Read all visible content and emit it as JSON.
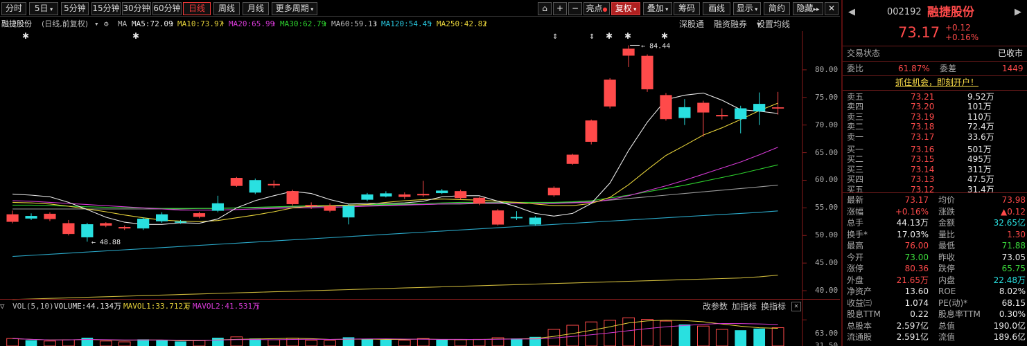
{
  "toolbar": {
    "periods": [
      "分时",
      "5日",
      "5分钟",
      "15分钟",
      "30分钟",
      "60分钟",
      "日线",
      "周线",
      "月线",
      "更多周期"
    ],
    "active_period": "日线",
    "tools": [
      "亮点",
      "复权",
      "叠加",
      "筹码",
      "画线",
      "显示",
      "简约",
      "隐藏"
    ],
    "plus": "+",
    "minus": "−"
  },
  "info": {
    "name": "融捷股份",
    "mode": "(日线,前复权)",
    "ma_label": "MA",
    "ma5": "MA5:72.09",
    "ma10": "MA10:73.97",
    "ma20": "MA20:65.99",
    "ma30": "MA30:62.79",
    "ma60": "MA60:59.13",
    "ma120": "MA120:54.45",
    "ma250": "MA250:42.82",
    "links": [
      "深股通",
      "融资融券",
      "设置均线"
    ]
  },
  "chart_data": {
    "type": "candlestick",
    "y_ticks": [
      "80.00",
      "75.00",
      "70.00",
      "65.00",
      "60.00",
      "55.00",
      "50.00",
      "45.00",
      "40.00"
    ],
    "ylim": [
      37.5,
      84.5
    ],
    "high_marker": "84.44",
    "low_marker": "48.88",
    "candles": [
      {
        "o": 52.5,
        "c": 53.8,
        "h": 54.5,
        "l": 52.2
      },
      {
        "o": 53.5,
        "c": 53.1,
        "h": 54.0,
        "l": 52.8
      },
      {
        "o": 53.0,
        "c": 53.9,
        "h": 54.2,
        "l": 52.6
      },
      {
        "o": 50.3,
        "c": 52.2,
        "h": 52.8,
        "l": 50.0
      },
      {
        "o": 52.0,
        "c": 49.7,
        "h": 52.3,
        "l": 48.88
      },
      {
        "o": 51.8,
        "c": 52.2,
        "h": 52.4,
        "l": 51.5
      },
      {
        "o": 51.3,
        "c": 51.5,
        "h": 51.8,
        "l": 51.0
      },
      {
        "o": 53.0,
        "c": 51.3,
        "h": 53.3,
        "l": 51.0
      },
      {
        "o": 53.8,
        "c": 52.6,
        "h": 54.2,
        "l": 52.3
      },
      {
        "o": 52.5,
        "c": 52.4,
        "h": 52.8,
        "l": 52.1
      },
      {
        "o": 53.4,
        "c": 54.0,
        "h": 54.3,
        "l": 53.1
      },
      {
        "o": 55.8,
        "c": 54.5,
        "h": 57.2,
        "l": 54.2
      },
      {
        "o": 59.0,
        "c": 60.4,
        "h": 60.6,
        "l": 58.8
      },
      {
        "o": 60.0,
        "c": 57.8,
        "h": 60.3,
        "l": 57.5
      },
      {
        "o": 59.1,
        "c": 59.3,
        "h": 60.0,
        "l": 58.6
      },
      {
        "o": 55.7,
        "c": 58.0,
        "h": 58.3,
        "l": 55.4
      },
      {
        "o": 55.4,
        "c": 55.5,
        "h": 56.0,
        "l": 54.8
      },
      {
        "o": 54.5,
        "c": 55.3,
        "h": 55.8,
        "l": 54.2
      },
      {
        "o": 55.3,
        "c": 53.3,
        "h": 55.6,
        "l": 52.0
      },
      {
        "o": 57.4,
        "c": 56.5,
        "h": 57.7,
        "l": 56.2
      },
      {
        "o": 57.6,
        "c": 57.1,
        "h": 58.0,
        "l": 56.9
      },
      {
        "o": 57.0,
        "c": 57.4,
        "h": 57.8,
        "l": 56.6
      },
      {
        "o": 57.3,
        "c": 57.5,
        "h": 59.9,
        "l": 57.0
      },
      {
        "o": 58.1,
        "c": 57.7,
        "h": 58.4,
        "l": 57.5
      },
      {
        "o": 56.8,
        "c": 58.0,
        "h": 58.3,
        "l": 56.5
      },
      {
        "o": 55.8,
        "c": 56.8,
        "h": 57.0,
        "l": 55.5
      },
      {
        "o": 52.0,
        "c": 54.5,
        "h": 54.8,
        "l": 51.8
      },
      {
        "o": 53.3,
        "c": 53.2,
        "h": 54.4,
        "l": 52.8
      },
      {
        "o": 53.2,
        "c": 52.0,
        "h": 53.5,
        "l": 51.8
      },
      {
        "o": 57.3,
        "c": 58.6,
        "h": 58.9,
        "l": 57.0
      },
      {
        "o": 63.0,
        "c": 64.6,
        "h": 64.8,
        "l": 62.8
      },
      {
        "o": 67.0,
        "c": 70.8,
        "h": 71.0,
        "l": 66.5
      },
      {
        "o": 73.4,
        "c": 78.2,
        "h": 78.5,
        "l": 73.0
      },
      {
        "o": 82.6,
        "c": 83.8,
        "h": 84.44,
        "l": 80.5
      },
      {
        "o": 76.5,
        "c": 82.5,
        "h": 82.8,
        "l": 76.0
      },
      {
        "o": 71.1,
        "c": 75.4,
        "h": 75.8,
        "l": 70.8
      },
      {
        "o": 73.2,
        "c": 71.3,
        "h": 74.7,
        "l": 70.0
      },
      {
        "o": 72.3,
        "c": 74.0,
        "h": 74.4,
        "l": 67.9
      },
      {
        "o": 71.6,
        "c": 71.8,
        "h": 73.0,
        "l": 71.0
      },
      {
        "o": 73.0,
        "c": 71.1,
        "h": 73.5,
        "l": 68.5
      },
      {
        "o": 73.8,
        "c": 72.5,
        "h": 75.9,
        "l": 70.0
      },
      {
        "o": 73.17,
        "c": 73.17,
        "h": 76.0,
        "l": 71.88
      }
    ],
    "ma5_line": [
      57.5,
      57.3,
      57.0,
      56.0,
      54.7,
      53.3,
      52.4,
      52.0,
      52.0,
      52.3,
      52.2,
      53.0,
      55.0,
      56.3,
      57.2,
      58.0,
      57.6,
      56.5,
      55.7,
      55.8,
      55.8,
      55.9,
      56.2,
      57.0,
      57.2,
      57.2,
      56.2,
      55.2,
      54.0,
      53.5,
      54.0,
      55.8,
      59.5,
      65.4,
      70.5,
      74.6,
      75.4,
      75.8,
      74.5,
      72.8,
      72.5,
      72.09
    ],
    "ma10_line": [
      56.0,
      55.9,
      55.7,
      55.3,
      54.8,
      54.3,
      53.7,
      53.2,
      52.8,
      52.6,
      52.5,
      52.7,
      53.2,
      53.7,
      54.3,
      55.0,
      55.3,
      55.4,
      55.5,
      55.6,
      56.0,
      56.3,
      56.5,
      56.6,
      56.5,
      56.4,
      56.2,
      56.0,
      55.7,
      55.4,
      55.4,
      55.8,
      56.9,
      59.2,
      61.9,
      64.5,
      66.3,
      68.2,
      69.5,
      71.0,
      72.6,
      73.97
    ],
    "ma20_line": [
      56.3,
      56.2,
      56.0,
      55.8,
      55.6,
      55.4,
      55.2,
      55.0,
      54.8,
      54.6,
      54.6,
      54.6,
      54.7,
      54.8,
      54.9,
      55.0,
      55.0,
      55.1,
      55.2,
      55.3,
      55.4,
      55.5,
      55.6,
      55.7,
      55.8,
      55.9,
      55.9,
      55.8,
      55.8,
      55.8,
      55.9,
      56.0,
      56.5,
      57.2,
      58.1,
      59.0,
      60.0,
      61.1,
      62.2,
      63.3,
      64.6,
      65.99
    ],
    "ma30_line": [
      55.5,
      55.5,
      55.4,
      55.3,
      55.2,
      55.1,
      55.0,
      55.0,
      54.9,
      54.9,
      54.9,
      54.9,
      55.0,
      55.1,
      55.2,
      55.3,
      55.4,
      55.4,
      55.5,
      55.6,
      55.6,
      55.7,
      55.8,
      55.9,
      56.0,
      56.0,
      56.0,
      56.0,
      56.0,
      56.0,
      56.1,
      56.3,
      56.8,
      57.3,
      57.9,
      58.5,
      59.1,
      59.8,
      60.5,
      61.2,
      62.0,
      62.79
    ],
    "ma60_line": [
      54.8,
      54.8,
      54.8,
      54.8,
      54.8,
      54.8,
      54.8,
      54.8,
      54.8,
      54.8,
      54.9,
      54.9,
      55.0,
      55.0,
      55.1,
      55.2,
      55.2,
      55.3,
      55.4,
      55.5,
      55.5,
      55.6,
      55.6,
      55.7,
      55.7,
      55.8,
      55.8,
      55.8,
      55.8,
      55.9,
      56.0,
      56.1,
      56.4,
      56.7,
      57.0,
      57.3,
      57.6,
      57.9,
      58.2,
      58.5,
      58.8,
      59.13
    ],
    "ma120_line": [
      46.2,
      46.4,
      46.6,
      46.8,
      47.0,
      47.2,
      47.4,
      47.6,
      47.8,
      48.0,
      48.2,
      48.4,
      48.6,
      48.8,
      49.0,
      49.2,
      49.4,
      49.6,
      49.8,
      50.0,
      50.2,
      50.4,
      50.6,
      50.8,
      51.0,
      51.2,
      51.4,
      51.6,
      51.8,
      52.0,
      52.2,
      52.4,
      52.6,
      52.8,
      53.0,
      53.2,
      53.4,
      53.6,
      53.8,
      54.0,
      54.2,
      54.45
    ],
    "ma250_line": [
      38.4,
      38.5,
      38.6,
      38.7,
      38.8,
      38.9,
      39.0,
      39.1,
      39.2,
      39.3,
      39.4,
      39.5,
      39.6,
      39.7,
      39.8,
      39.9,
      40.0,
      40.1,
      40.2,
      40.3,
      40.4,
      40.5,
      40.6,
      40.7,
      40.8,
      40.9,
      41.0,
      41.1,
      41.2,
      41.3,
      41.4,
      41.5,
      41.6,
      41.7,
      41.8,
      41.9,
      42.0,
      42.1,
      42.2,
      42.3,
      42.5,
      42.82
    ],
    "volume": [
      18,
      14,
      12,
      15,
      20,
      12,
      10,
      16,
      14,
      11,
      13,
      20,
      22,
      18,
      15,
      19,
      14,
      13,
      21,
      16,
      15,
      14,
      18,
      15,
      15,
      16,
      20,
      18,
      22,
      40,
      50,
      58,
      62,
      68,
      64,
      60,
      52,
      48,
      40,
      38,
      42,
      44.134
    ]
  },
  "vol": {
    "label": "VOL(5,10)",
    "volume": "VOLUME:44.134万",
    "mavol1": "MAVOL1:33.712万",
    "mavol2": "MAVOL2:41.531万",
    "links": [
      "改参数",
      "加指标",
      "换指标"
    ],
    "y_ticks": [
      "63.00",
      "31.50"
    ],
    "ylim": [
      0,
      75
    ]
  },
  "panel": {
    "code": "002192",
    "name": "融捷股份",
    "price": "73.17",
    "change": "+0.12",
    "change_pct": "+0.16%",
    "status_label": "交易状态",
    "status_value": "已收市",
    "webi_label": "委比",
    "webi_value": "61.87%",
    "weicha_label": "委差",
    "weicha_value": "1449",
    "promo": "抓住机会，即刻开户！",
    "sells": [
      {
        "label": "卖五",
        "price": "73.21",
        "vol": "9.52万"
      },
      {
        "label": "卖四",
        "price": "73.20",
        "vol": "101万"
      },
      {
        "label": "卖三",
        "price": "73.19",
        "vol": "110万"
      },
      {
        "label": "卖二",
        "price": "73.18",
        "vol": "72.4万"
      },
      {
        "label": "卖一",
        "price": "73.17",
        "vol": "33.6万"
      }
    ],
    "buys": [
      {
        "label": "买一",
        "price": "73.16",
        "vol": "501万"
      },
      {
        "label": "买二",
        "price": "73.15",
        "vol": "495万"
      },
      {
        "label": "买三",
        "price": "73.14",
        "vol": "311万"
      },
      {
        "label": "买四",
        "price": "73.13",
        "vol": "47.5万"
      },
      {
        "label": "买五",
        "price": "73.12",
        "vol": "31.4万"
      }
    ],
    "stats": [
      {
        "l1": "最新",
        "v1": "73.17",
        "c1": "red",
        "l2": "均价",
        "v2": "73.98",
        "c2": "red"
      },
      {
        "l1": "涨幅",
        "v1": "+0.16%",
        "c1": "red",
        "l2": "涨跌",
        "v2": "▲0.12",
        "c2": "red"
      },
      {
        "l1": "总手",
        "v1": "44.13万",
        "c1": "white",
        "l2": "金额",
        "v2": "32.65亿",
        "c2": "cyan"
      },
      {
        "l1": "换手*",
        "v1": "17.03%",
        "c1": "white",
        "l2": "量比",
        "v2": "1.30",
        "c2": "red"
      },
      {
        "l1": "最高",
        "v1": "76.00",
        "c1": "red",
        "l2": "最低",
        "v2": "71.88",
        "c2": "green"
      },
      {
        "l1": "今开",
        "v1": "73.00",
        "c1": "green",
        "l2": "昨收",
        "v2": "73.05",
        "c2": "white"
      },
      {
        "l1": "涨停",
        "v1": "80.36",
        "c1": "red",
        "l2": "跌停",
        "v2": "65.75",
        "c2": "green"
      },
      {
        "l1": "外盘",
        "v1": "21.65万",
        "c1": "red",
        "l2": "内盘",
        "v2": "22.48万",
        "c2": "cyan"
      },
      {
        "l1": "净资产",
        "v1": "13.60",
        "c1": "white",
        "l2": "ROE",
        "v2": "8.02%",
        "c2": "white"
      },
      {
        "l1": "收益㈢",
        "v1": "1.074",
        "c1": "white",
        "l2": "PE(动)*",
        "v2": "68.15",
        "c2": "white"
      },
      {
        "l1": "股息TTM",
        "v1": "0.22",
        "c1": "white",
        "l2": "股息率TTM",
        "v2": "0.30%",
        "c2": "white"
      },
      {
        "l1": "总股本",
        "v1": "2.597亿",
        "c1": "white",
        "l2": "总值",
        "v2": "190.0亿",
        "c2": "white"
      },
      {
        "l1": "流通股",
        "v1": "2.591亿",
        "c1": "white",
        "l2": "流值",
        "v2": "189.6亿",
        "c2": "white"
      }
    ]
  },
  "colors": {
    "up": "#ff4a4a",
    "down": "#29e0e0",
    "ma5": "#e8e8e8",
    "ma10": "#e6d23a",
    "ma20": "#d63ad6",
    "ma30": "#2ed12e",
    "ma60": "#9a9a9a",
    "ma120": "#2aa8c8",
    "ma250": "#c8b43a"
  }
}
